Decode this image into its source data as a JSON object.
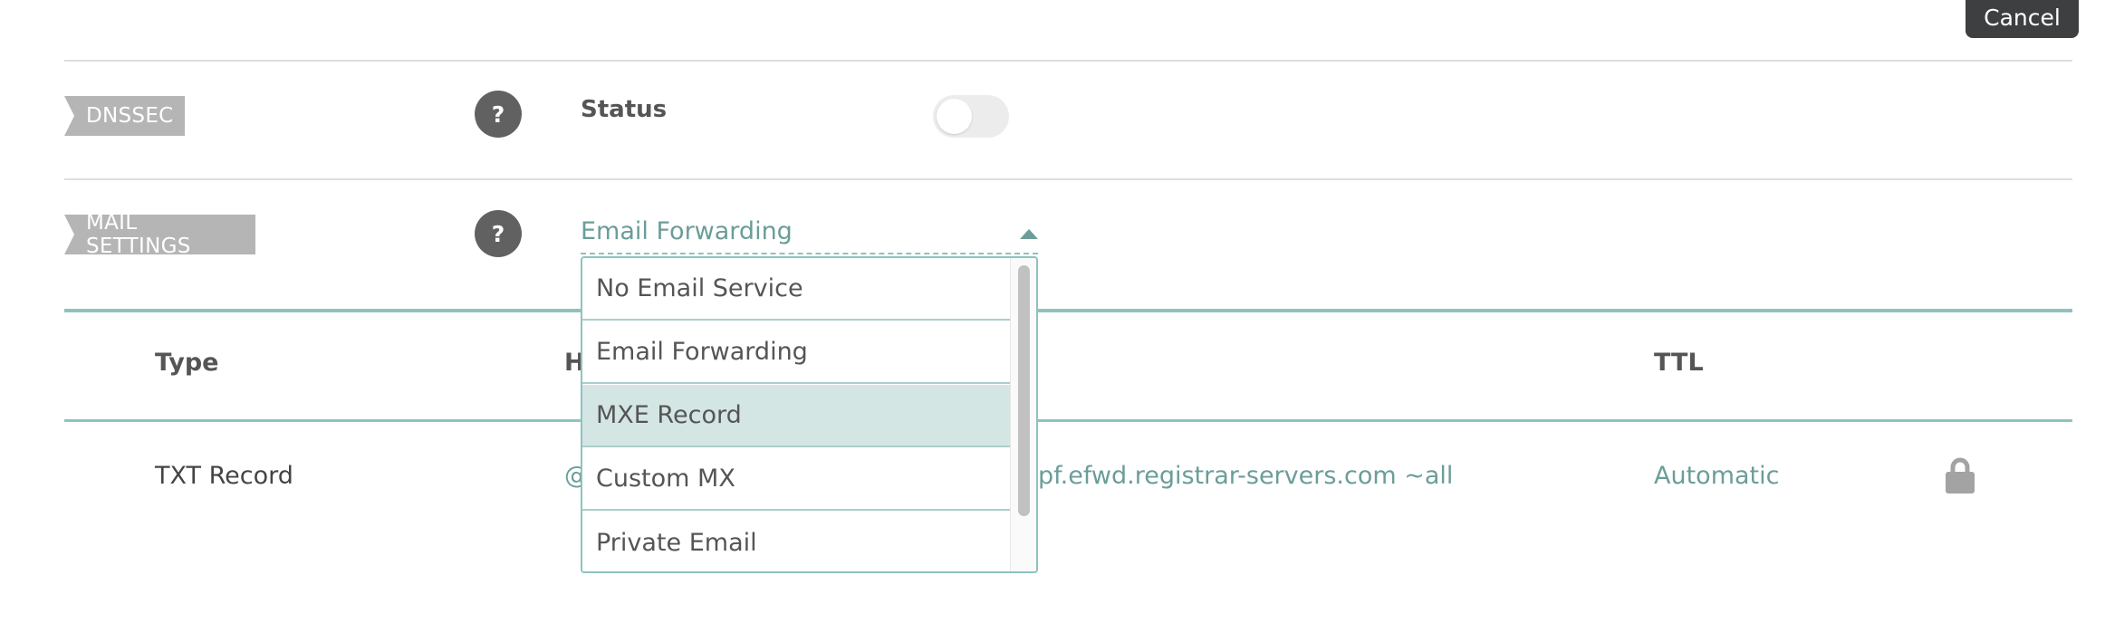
{
  "header": {
    "cancel_label": "Cancel"
  },
  "dnssec": {
    "tag": "DNSSEC",
    "help": "?",
    "status_label": "Status",
    "toggle_on": false
  },
  "mail_settings": {
    "tag": "MAIL SETTINGS",
    "help": "?",
    "selected_value": "Email Forwarding",
    "options": [
      {
        "label": "No Email Service"
      },
      {
        "label": "Email Forwarding"
      },
      {
        "label": "MXE Record",
        "highlighted": true
      },
      {
        "label": "Custom MX"
      },
      {
        "label": "Private Email"
      }
    ]
  },
  "table": {
    "headers": {
      "type": "Type",
      "host": "H",
      "ttl": "TTL"
    },
    "rows": [
      {
        "type": "TXT Record",
        "host": "@",
        "value": "pf.efwd.registrar-servers.com ~all",
        "ttl": "Automatic",
        "locked": true
      }
    ]
  },
  "colors": {
    "accent_teal": "#8ec3bf",
    "teal_text": "#6b9d99",
    "tag_gray": "#b5b5b5",
    "help_gray": "#616161",
    "cancel_dark": "#3d3f41"
  },
  "icons": [
    "help-icon",
    "lock-icon",
    "caret-up-icon"
  ]
}
